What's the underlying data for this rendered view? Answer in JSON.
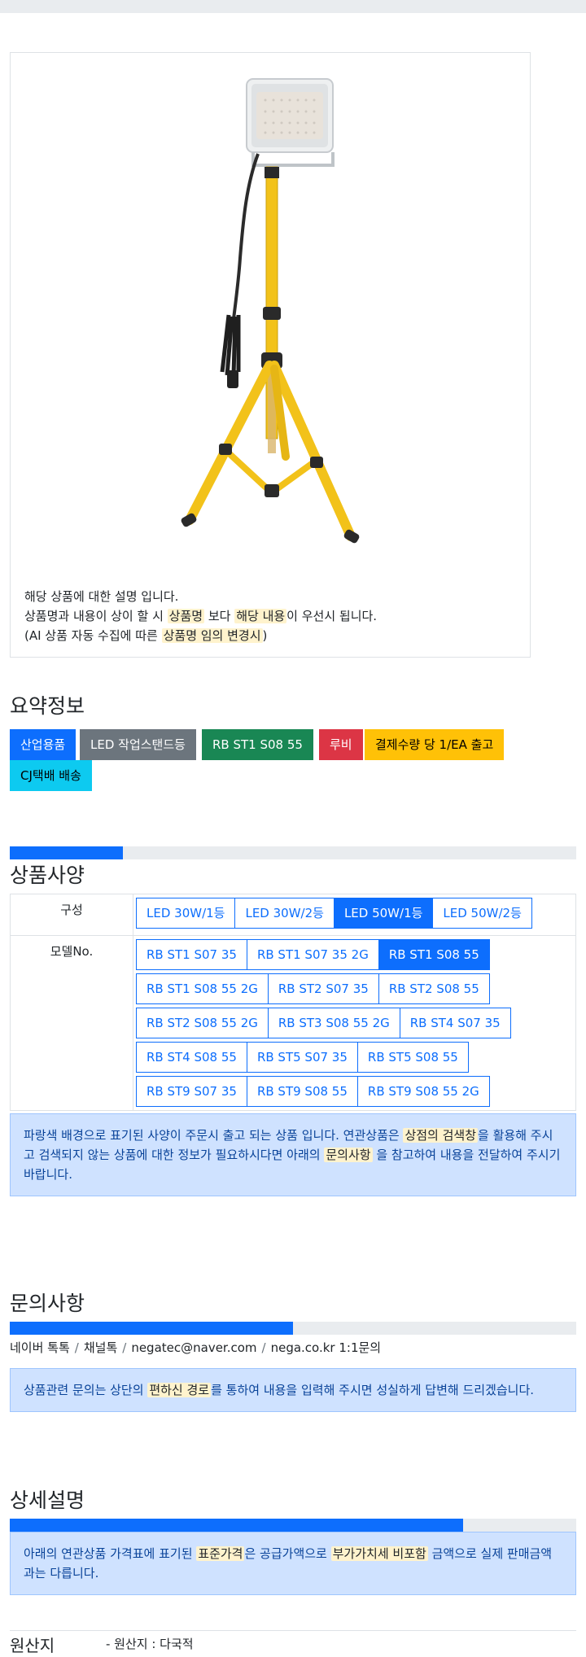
{
  "product_card": {
    "description_line1": "해당 상품에 대한 설명 입니다.",
    "description_line2": {
      "before": "상품명과 내용이 상이 할 시 ",
      "mark1": "상품명",
      "middle": " 보다 ",
      "mark2": "해당 내용",
      "after": "이 우선시 됩니다."
    },
    "description_line3": {
      "before": "(AI 상품 자동 수집에 따른 ",
      "mark": "상품명 임의 변경시",
      "after": ")"
    }
  },
  "summary": {
    "title": "요약정보",
    "badges": [
      {
        "label": "산업용품",
        "color": "#0d6efd"
      },
      {
        "label": "LED 작업스탠드등",
        "color": "#6c757d"
      },
      {
        "label": "RB ST1 S08 55",
        "color": "#198754"
      },
      {
        "label": "루비",
        "color": "#dc3545"
      },
      {
        "label": "결제수량 당 1/EA 출고",
        "color": "#ffc107"
      },
      {
        "label": "CJ택배 배송",
        "color": "#0dcaf0"
      }
    ]
  },
  "specs": {
    "title": "상품사양",
    "progress_fraction": 0.2,
    "rows": [
      {
        "label": "구성",
        "options": [
          {
            "label": "LED 30W/1등",
            "active": false
          },
          {
            "label": "LED 30W/2등",
            "active": false
          },
          {
            "label": "LED 50W/1등",
            "active": true
          },
          {
            "label": "LED 50W/2등",
            "active": false
          }
        ]
      },
      {
        "label": "모델No.",
        "options": [
          {
            "label": "RB ST1 S07 35",
            "active": false
          },
          {
            "label": "RB ST1 S07 35 2G",
            "active": false
          },
          {
            "label": "RB ST1 S08 55",
            "active": true
          },
          {
            "label": "RB ST1 S08 55 2G",
            "active": false
          },
          {
            "label": "RB ST2 S07 35",
            "active": false
          },
          {
            "label": "RB ST2 S08 55",
            "active": false
          },
          {
            "label": "RB ST2 S08 55 2G",
            "active": false
          },
          {
            "label": "RB ST3 S08 55 2G",
            "active": false
          },
          {
            "label": "RB ST4 S07 35",
            "active": false
          },
          {
            "label": "RB ST4 S08 55",
            "active": false
          },
          {
            "label": "RB ST5 S07 35",
            "active": false
          },
          {
            "label": "RB ST5 S08 55",
            "active": false
          },
          {
            "label": "RB ST9 S07 35",
            "active": false
          },
          {
            "label": "RB ST9 S08 55",
            "active": false
          },
          {
            "label": "RB ST9 S08 55 2G",
            "active": false
          }
        ]
      }
    ],
    "notice": {
      "before": "파랑색 배경으로 표기된 사양이 주문시 출고 되는 상품 입니다. 연관상품은 ",
      "mark1": "상점의 검색창",
      "middle1": "을 활용해 주시고 검색되지 않는 상품에 대한 정보가 필요하시다면 아래의 ",
      "mark2": "문의사항",
      "after": " 을 참고하여 내용을 전달하여 주시기 바랍니다."
    }
  },
  "inquiry": {
    "title": "문의사항",
    "progress_fraction": 0.5,
    "contacts": [
      "네이버 톡톡",
      "채널톡",
      "negatec@naver.com",
      "nega.co.kr 1:1문의"
    ],
    "separator": "/",
    "notice": {
      "before": "상품관련 문의는 상단의 ",
      "mark": "편하신 경로",
      "after": "를 통하여 내용을 입력해 주시면 성실하게 답변해 드리겠습니다."
    }
  },
  "detail": {
    "title": "상세설명",
    "progress_fraction": 0.8,
    "notice": {
      "before": "아래의 연관상품 가격표에 표기된 ",
      "mark1": "표준가격",
      "middle": "은 공급가액으로 ",
      "mark2": "부가가치세 비포함",
      "after": " 금액으로 실제 판매금액과는 다릅니다."
    }
  },
  "origin": {
    "label": "원산지",
    "value": "- 원산지 : 다국적"
  }
}
